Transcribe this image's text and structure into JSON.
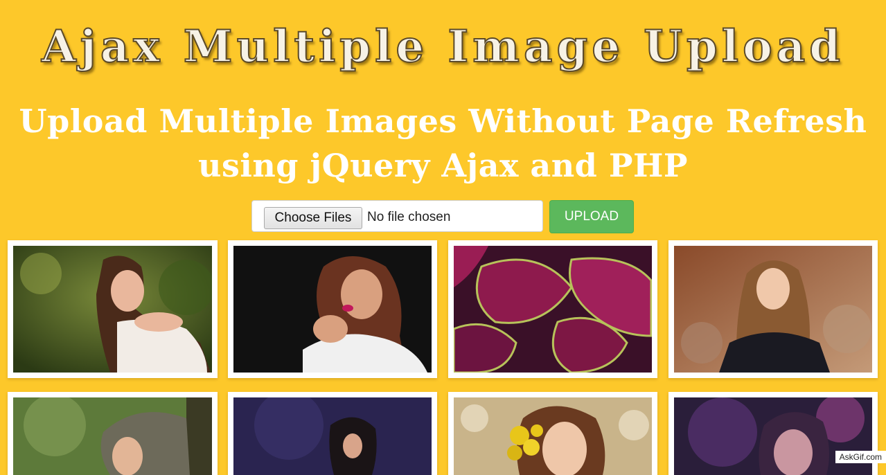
{
  "header": {
    "title": "Ajax Multiple Image Upload",
    "subtitle_line1": "Upload Multiple Images Without Page Refresh",
    "subtitle_line2": "using jQuery Ajax and PHP"
  },
  "upload_form": {
    "choose_button_label": "Choose Files",
    "file_status": "No file chosen",
    "upload_button_label": "UPLOAD"
  },
  "gallery": {
    "images": [
      {
        "subject": "woman-in-white-lace-outdoors-photo"
      },
      {
        "subject": "woman-with-pink-lips-dark-background-photo"
      },
      {
        "subject": "purple-coleus-leaves-photo"
      },
      {
        "subject": "woman-in-black-top-rocky-background-photo"
      },
      {
        "subject": "woman-in-green-forest-photo"
      },
      {
        "subject": "woman-on-dark-purple-background-photo"
      },
      {
        "subject": "woman-with-yellow-flowers-photo"
      },
      {
        "subject": "woman-purple-dust-effect-photo"
      }
    ]
  },
  "watermark": "AskGif.com",
  "colors": {
    "background": "#fdc82a",
    "upload_button": "#5cb85c",
    "card": "#ffffff"
  }
}
